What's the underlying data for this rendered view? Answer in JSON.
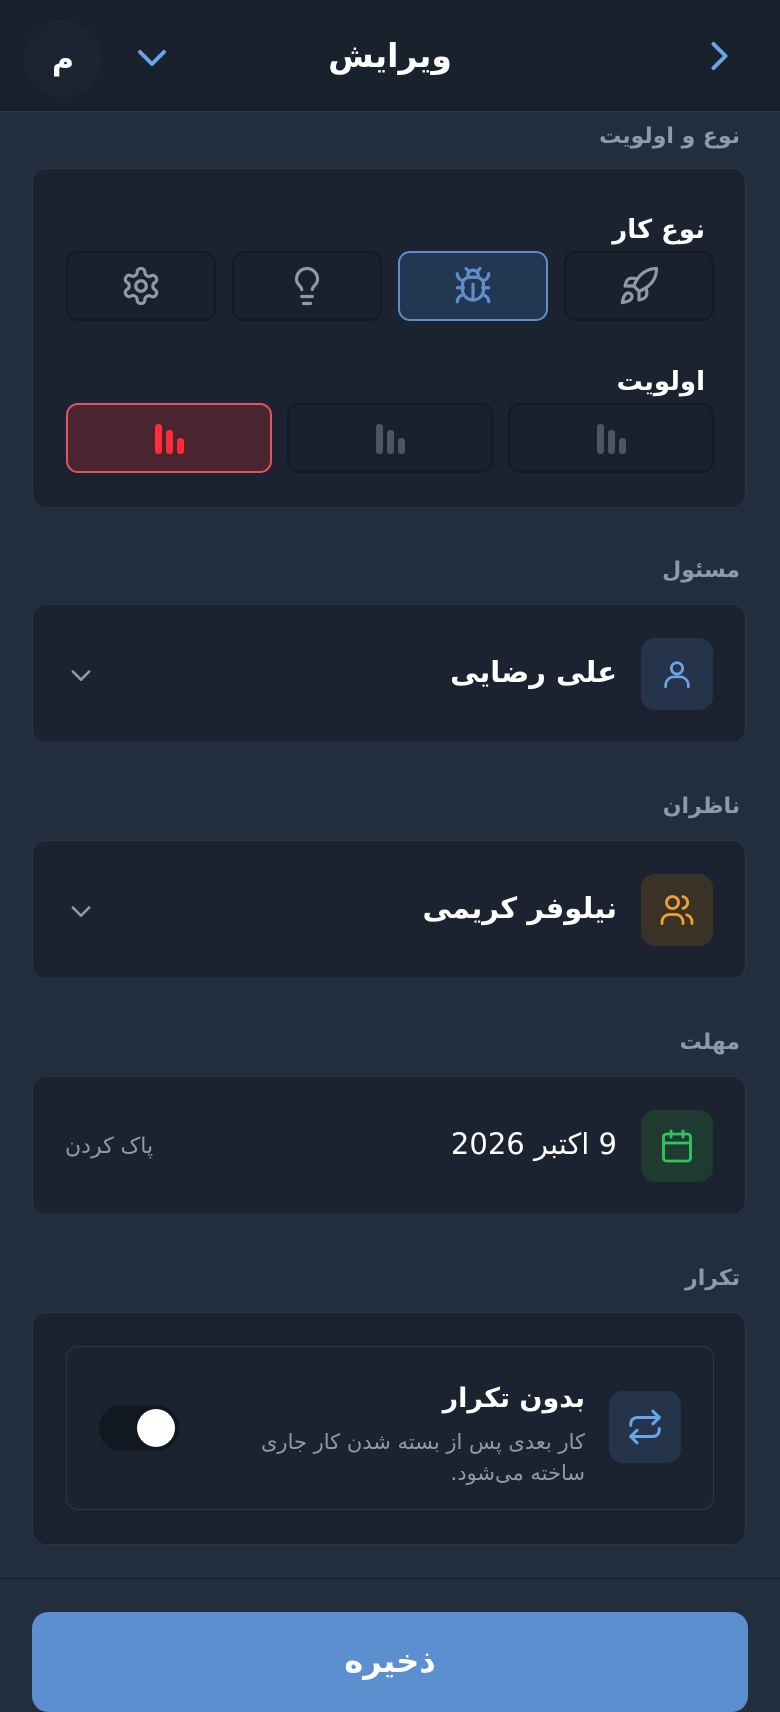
{
  "header": {
    "title": "ویرایش",
    "avatar_initial": "م"
  },
  "type_priority": {
    "section_label": "نوع و اولویت",
    "type_label": "نوع کار",
    "type_options": [
      "rocket-icon",
      "bug-icon",
      "lightbulb-icon",
      "gear-icon"
    ],
    "type_selected": "bug-icon",
    "priority_label": "اولویت",
    "priority_levels": 3,
    "priority_selected": 3
  },
  "assignee": {
    "section_label": "مسئول",
    "value": "علی رضایی",
    "icon": "user-icon"
  },
  "watchers": {
    "section_label": "ناظران",
    "value": "نیلوفر کریمی",
    "icon": "users-icon"
  },
  "deadline": {
    "section_label": "مهلت",
    "value": "9 اکتبر 2026",
    "clear_label": "پاک کردن",
    "icon": "calendar-icon"
  },
  "repeat": {
    "section_label": "تکرار",
    "title": "بدون تکرار",
    "description": "کار بعدی پس از بسته شدن کار جاری ساخته می‌شود.",
    "toggle_on": true,
    "icon": "repeat-icon"
  },
  "footer": {
    "save_label": "ذخیره"
  },
  "colors": {
    "accent_blue": "#5b8fcf",
    "danger_red": "#e0555e",
    "warning_orange": "#f0a030",
    "success_green": "#2fc55e"
  }
}
